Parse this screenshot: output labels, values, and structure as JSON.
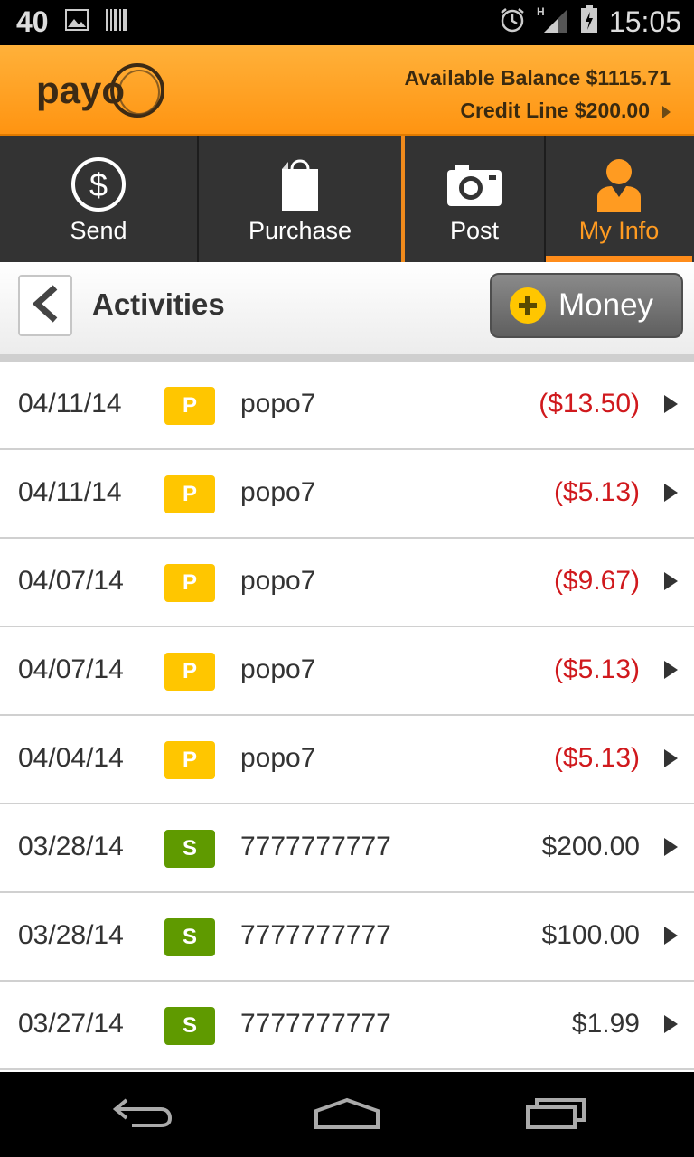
{
  "status_bar": {
    "left_number": "40",
    "time": "15:05",
    "network_label": "H"
  },
  "header": {
    "brand": "payo",
    "available_balance": "Available Balance $1115.71",
    "credit_line": "Credit Line $200.00"
  },
  "nav": {
    "tabs": [
      {
        "label": "Send",
        "icon": "dollar-circle-icon"
      },
      {
        "label": "Purchase",
        "icon": "shopping-bag-icon"
      },
      {
        "label": "Post",
        "icon": "camera-icon"
      },
      {
        "label": "My Info",
        "icon": "person-icon",
        "active": true
      }
    ]
  },
  "toolbar": {
    "title": "Activities",
    "money_label": "Money"
  },
  "colors": {
    "accent_orange": "#ff9411",
    "badge_p": "#ffc600",
    "badge_s": "#5f9a00",
    "negative_amount": "#d0191d"
  },
  "activities": [
    {
      "date": "04/11/14",
      "type": "P",
      "name": "popo7",
      "amount": "($13.50)",
      "negative": true
    },
    {
      "date": "04/11/14",
      "type": "P",
      "name": "popo7",
      "amount": "($5.13)",
      "negative": true
    },
    {
      "date": "04/07/14",
      "type": "P",
      "name": "popo7",
      "amount": "($9.67)",
      "negative": true
    },
    {
      "date": "04/07/14",
      "type": "P",
      "name": "popo7",
      "amount": "($5.13)",
      "negative": true
    },
    {
      "date": "04/04/14",
      "type": "P",
      "name": "popo7",
      "amount": "($5.13)",
      "negative": true
    },
    {
      "date": "03/28/14",
      "type": "S",
      "name": "7777777777",
      "amount": "$200.00",
      "negative": false
    },
    {
      "date": "03/28/14",
      "type": "S",
      "name": "7777777777",
      "amount": "$100.00",
      "negative": false
    },
    {
      "date": "03/27/14",
      "type": "S",
      "name": "7777777777",
      "amount": "$1.99",
      "negative": false
    }
  ]
}
